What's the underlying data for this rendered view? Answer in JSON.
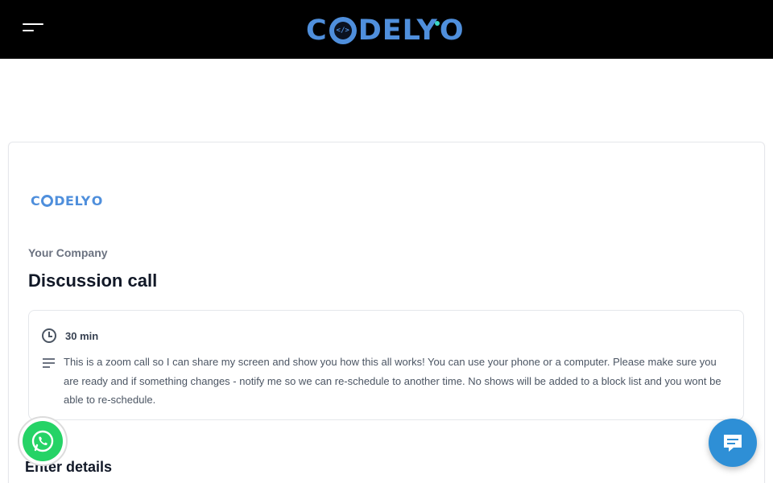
{
  "header": {
    "brand": {
      "part1": "C",
      "part2": "DELY",
      "part3": "O",
      "center_glyph": "</>"
    }
  },
  "card": {
    "logo": {
      "part1": "C",
      "part2": "DELY",
      "part3": "O"
    },
    "company": "Your Company",
    "title": "Discussion call",
    "duration": "30 min",
    "description": "This is a zoom call so I can share my screen and show you how this all works! You can use your phone or a computer. Please make sure you are ready and if something changes - notify me so we can re-schedule to another time. No shows will be added to a block list and you wont be able to re-schedule.",
    "enter_details": "Enter details"
  },
  "icons": {
    "menu": "hamburger-menu-icon",
    "clock": "clock-icon",
    "description": "text-lines-icon",
    "whatsapp": "whatsapp-icon",
    "chat": "chat-icon"
  },
  "colors": {
    "brand": "#4f8fdc",
    "accent_dot": "#39d8c4",
    "whatsapp": "#25d366",
    "chat": "#2e8fd6"
  }
}
